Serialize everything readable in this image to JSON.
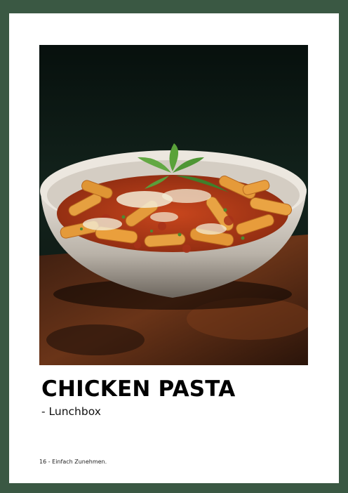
{
  "recipe": {
    "title": "CHICKEN PASTA",
    "subtitle": "- Lunchbox"
  },
  "footer": {
    "text": "16 - Einfach Zunehmen."
  }
}
